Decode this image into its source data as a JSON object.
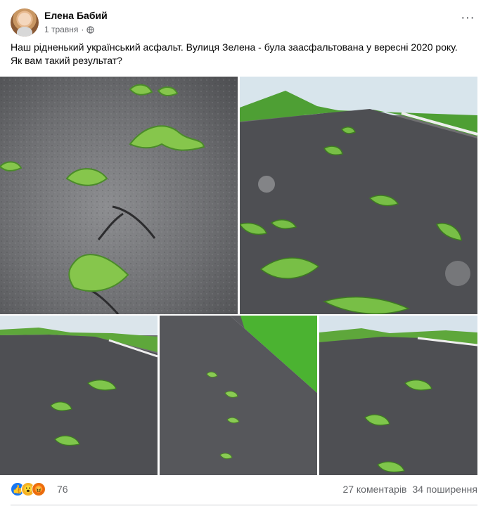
{
  "post": {
    "author": "Елена Бабий",
    "date": "1 травня",
    "separator": "·",
    "text": "Наш рідненький український асфальт. Вулиця Зелена - була заасфальтована у вересні 2020 року. Як вам такий результат?",
    "menu_label": "···",
    "privacy_icon": "globe-icon",
    "photos": [
      {
        "name": "photo-asphalt-closeup"
      },
      {
        "name": "photo-road-perspective"
      },
      {
        "name": "photo-road-left"
      },
      {
        "name": "photo-road-center"
      },
      {
        "name": "photo-road-right"
      }
    ],
    "reactions": {
      "count": "76",
      "icons": [
        "like-icon",
        "wow-icon",
        "angry-icon"
      ]
    },
    "comments": "27 коментарів",
    "shares": "34 поширення"
  },
  "colors": {
    "meta": "#65676b",
    "like": "#1877f2",
    "wow": "#f7b125",
    "angry": "#e9710f"
  }
}
